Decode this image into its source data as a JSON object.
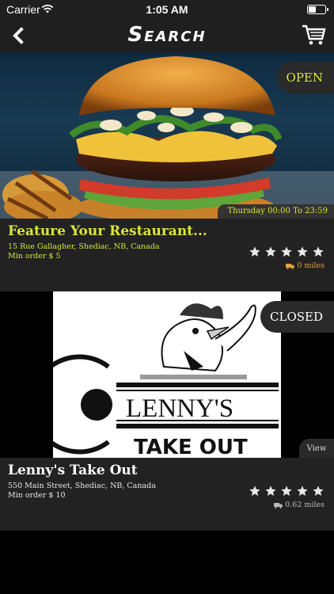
{
  "status_bar": {
    "carrier": "Carrier",
    "time": "1:05 AM"
  },
  "nav": {
    "title": "Search",
    "back_icon": "chevron-left-icon",
    "cart_icon": "cart-icon"
  },
  "restaurants": [
    {
      "status": "OPEN",
      "hours": "Thursday 00:00 To 23:59",
      "name": "Feature Your Restaurant...",
      "address": "15 Rue Gallagher, Shediac, NB, Canada",
      "min_order": "Min order $ 5",
      "distance": "0 miles",
      "rating": 5,
      "accent_color": "#d8e63a"
    },
    {
      "status": "CLOSED",
      "view_label": "View",
      "name": "Lenny's Take Out",
      "address": "550 Main Street, Shediac, NB, Canada",
      "min_order": "Min order $ 10",
      "distance": "0.62 miles",
      "rating": 5,
      "logo_text_1": "LENNY'S",
      "logo_text_2": "TAKE OUT"
    }
  ]
}
